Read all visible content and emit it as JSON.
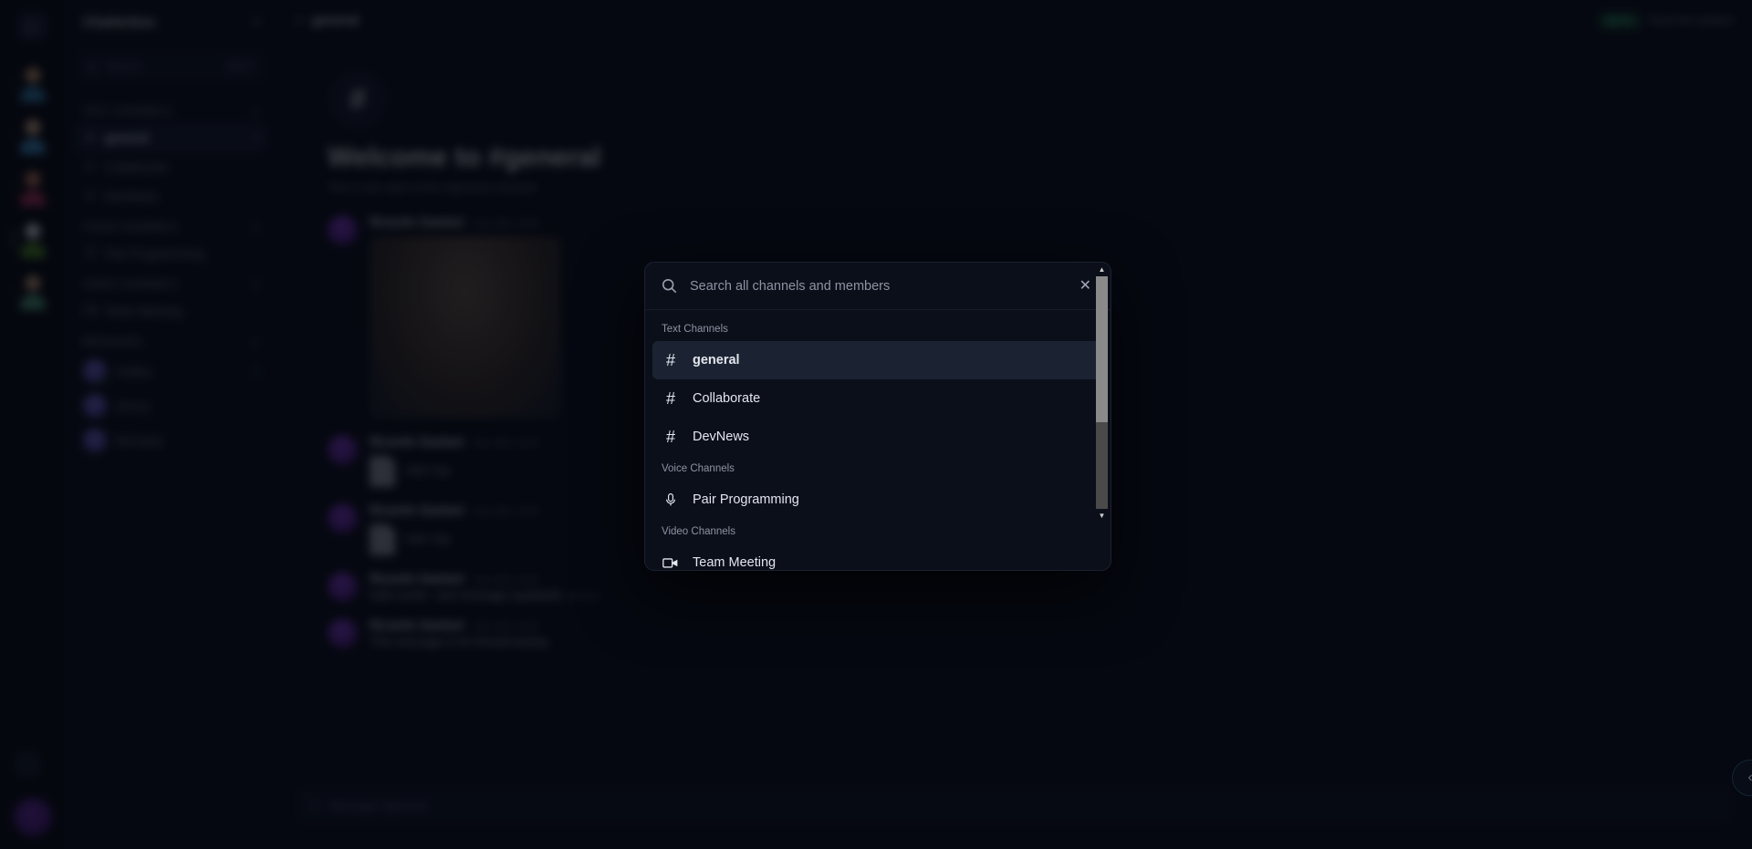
{
  "workspace": {
    "name": "Chatterbox",
    "chevron_icon": "chevron-down-icon",
    "search_placeholder": "Search",
    "search_shortcut": "Ctrl K"
  },
  "rail": {
    "logo_icon": "app-logo-icon",
    "servers": [
      {
        "name": "server-1",
        "selected": false,
        "head": "#c79a6b",
        "body": "#2f7fae"
      },
      {
        "name": "server-2",
        "selected": false,
        "head": "#d9b08c",
        "body": "#3f8fc4"
      },
      {
        "name": "server-3",
        "selected": false,
        "head": "#c8795e",
        "body": "#b3335c"
      },
      {
        "name": "server-4",
        "selected": true,
        "head": "#dfe3ea",
        "body": "#4e8b1f"
      },
      {
        "name": "server-5",
        "selected": false,
        "head": "#caa07a",
        "body": "#4f9e7a"
      }
    ],
    "settings_icon": "gear-icon",
    "user_avatar_icon": "user-avatar-icon"
  },
  "sidebar": {
    "groups": [
      {
        "label": "TEXT CHANNELS",
        "add_icon": "plus-icon",
        "items": [
          {
            "icon": "hash-icon",
            "label": "general",
            "active": true,
            "trail": "1"
          },
          {
            "icon": "hash-icon",
            "label": "Collaborate",
            "active": false,
            "trail": ""
          },
          {
            "icon": "hash-icon",
            "label": "DevNews",
            "active": false,
            "trail": ""
          }
        ]
      },
      {
        "label": "VOICE CHANNELS",
        "add_icon": "plus-icon",
        "items": [
          {
            "icon": "microphone-icon",
            "label": "Pair Programming",
            "active": false,
            "trail": ""
          }
        ]
      },
      {
        "label": "VIDEO CHANNELS",
        "add_icon": "plus-icon",
        "items": [
          {
            "icon": "video-camera-icon",
            "label": "Team Meeting",
            "active": false,
            "trail": ""
          }
        ]
      }
    ],
    "dm_group": {
      "label": "MESSAGES",
      "add_icon": "plus-icon",
      "items": [
        {
          "name": "Hadley",
          "online": true,
          "badge": "2"
        },
        {
          "name": "Jimmy",
          "online": false,
          "badge": ""
        },
        {
          "name": "Michaela",
          "online": false,
          "badge": ""
        }
      ]
    }
  },
  "header": {
    "hash_icon": "hash-icon",
    "channel": "general",
    "badge": "BETA",
    "note": "Real-time updates"
  },
  "welcome": {
    "icon": "hash-icon",
    "title": "Welcome to #general",
    "subtitle": "This is the start of the #general channel."
  },
  "messages": [
    {
      "author": "Ricardo Gaetani",
      "timestamp": "Sep 18th, 2025",
      "text": "",
      "attachment": "",
      "hero": true
    },
    {
      "author": "Ricardo Gaetani",
      "timestamp": "Sep 18th, 2025",
      "text": "",
      "attachment": "PDF File",
      "hero": false
    },
    {
      "author": "Ricardo Gaetani",
      "timestamp": "Sep 18th, 2025",
      "text": "",
      "attachment": "PDF File",
      "hero": false
    },
    {
      "author": "Ricardo Gaetani",
      "timestamp": "Sep 18th, 2025",
      "text": "hello world - test message (updated)",
      "edited": "(edited)",
      "attachment": "",
      "hero": false
    },
    {
      "author": "Ricardo Gaetani",
      "timestamp": "Sep 18th, 2025",
      "text": "This message is for thread testing",
      "attachment": "",
      "hero": false
    }
  ],
  "composer": {
    "add_icon": "plus-icon",
    "placeholder": "Message #general"
  },
  "collapse_button": {
    "icon": "chevron-left-icon"
  },
  "search_modal": {
    "search_icon": "search-icon",
    "placeholder": "Search all channels and members",
    "value": "",
    "close_icon": "close-icon",
    "groups": [
      {
        "label": "Text Channels",
        "items": [
          {
            "icon": "hash-icon",
            "label": "general",
            "selected": true
          },
          {
            "icon": "hash-icon",
            "label": "Collaborate",
            "selected": false
          },
          {
            "icon": "hash-icon",
            "label": "DevNews",
            "selected": false
          }
        ]
      },
      {
        "label": "Voice Channels",
        "items": [
          {
            "icon": "microphone-icon",
            "label": "Pair Programming",
            "selected": false
          }
        ]
      },
      {
        "label": "Video Channels",
        "items": [
          {
            "icon": "video-camera-icon",
            "label": "Team Meeting",
            "selected": false
          }
        ]
      }
    ]
  },
  "colors": {
    "accent": "#2f9e5e",
    "surface": "#0b0f1a",
    "selected": "#1b2332"
  }
}
